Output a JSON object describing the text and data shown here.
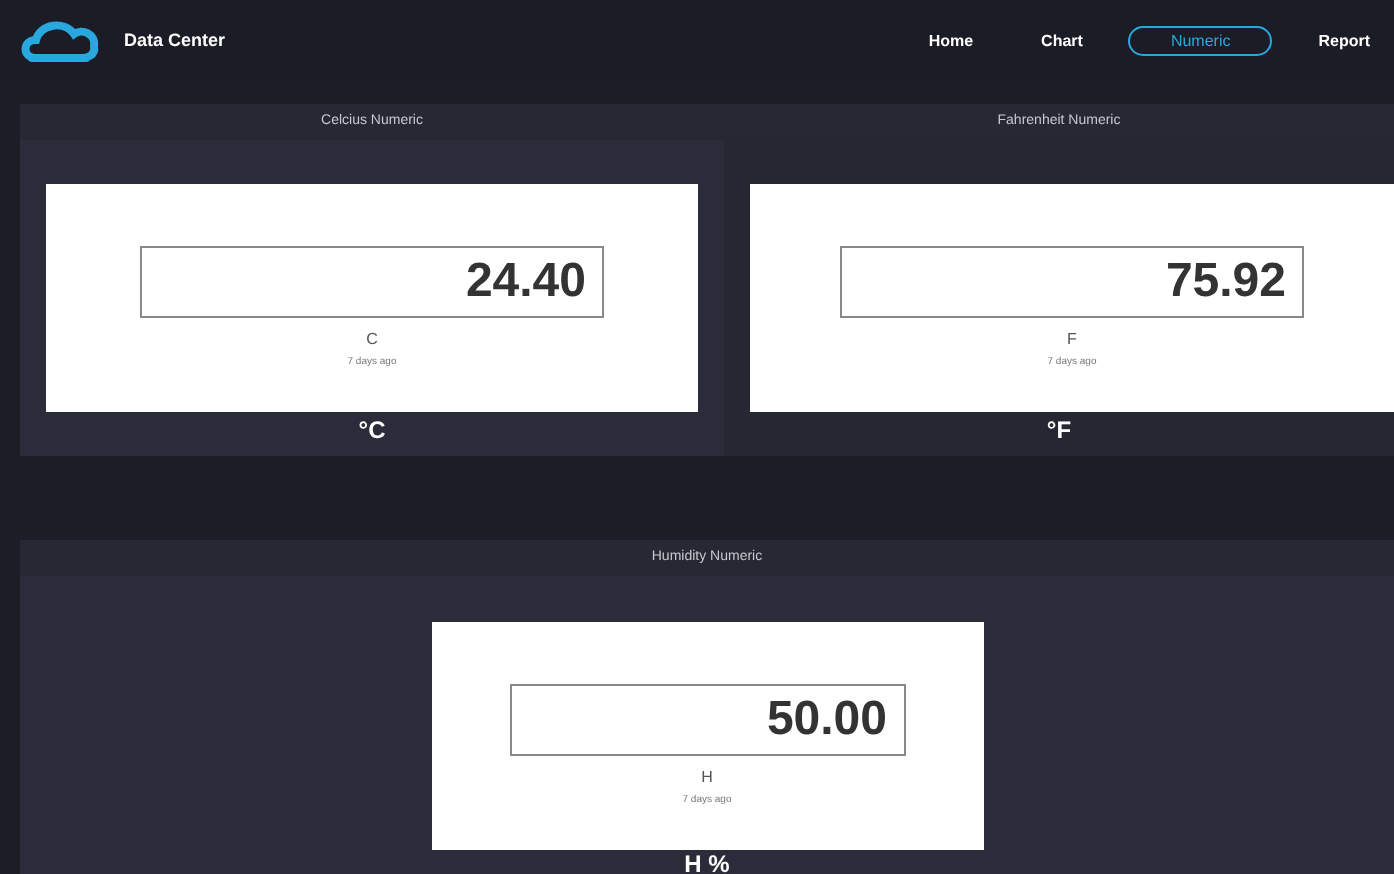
{
  "header": {
    "title": "Data Center"
  },
  "nav": [
    {
      "label": "Home",
      "selected": false
    },
    {
      "label": "Chart",
      "selected": false
    },
    {
      "label": "Numeric",
      "selected": true
    },
    {
      "label": "Report",
      "selected": false
    }
  ],
  "rows": [
    [
      {
        "title": "Celcius Numeric",
        "value": "24.40",
        "label": "C",
        "time": "7 days ago",
        "unit": "°C"
      },
      {
        "title": "Fahrenheit Numeric",
        "value": "75.92",
        "label": "F",
        "time": "7 days ago",
        "unit": "°F"
      }
    ],
    [
      {
        "title": "Humidity Numeric",
        "value": "50.00",
        "label": "H",
        "time": "7 days ago",
        "unit": "H %"
      }
    ]
  ]
}
